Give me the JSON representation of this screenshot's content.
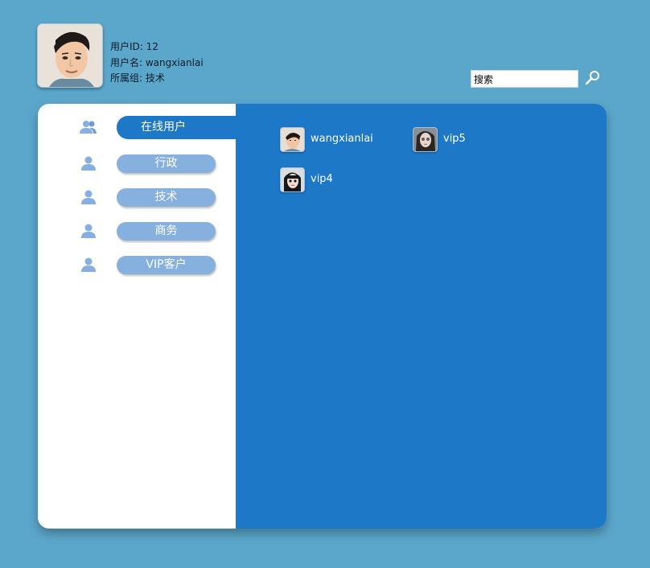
{
  "profile": {
    "id_label": "用户ID: 12",
    "name_label": "用户名: wangxianlai",
    "group_label": "所属组: 技术"
  },
  "search": {
    "value": "搜索"
  },
  "sidebar": {
    "groups": [
      {
        "label": "在线用户",
        "icon": "users-icon",
        "active": true
      },
      {
        "label": "行政",
        "icon": "user-icon",
        "active": false
      },
      {
        "label": "技术",
        "icon": "user-icon",
        "active": false
      },
      {
        "label": "商务",
        "icon": "user-icon",
        "active": false
      },
      {
        "label": "VIP客户",
        "icon": "user-icon",
        "active": false
      }
    ]
  },
  "online_users": [
    {
      "name": "wangxianlai"
    },
    {
      "name": "vip5"
    },
    {
      "name": "vip4"
    }
  ],
  "colors": {
    "background": "#5ba7cb",
    "accent": "#1e78c8",
    "pill": "#86b0de",
    "panel": "#ffffff"
  }
}
